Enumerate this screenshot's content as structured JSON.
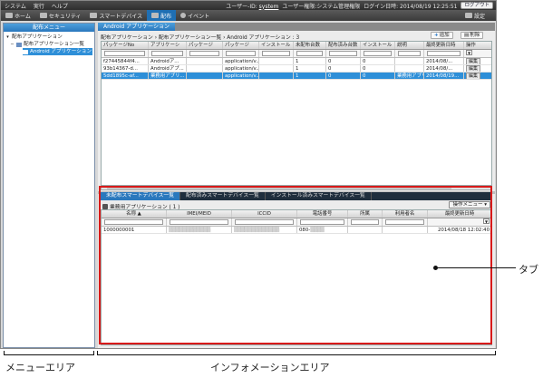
{
  "menubar": {
    "items": [
      "システム",
      "実行",
      "ヘルプ"
    ],
    "user_prefix": "ユーザー-ID:",
    "user_id": "system",
    "rights": "ユーザー権限:システム管理権限",
    "login": "ログイン日時: 2014/08/19 12:25:51",
    "logout": "ログアウト"
  },
  "tabbar": {
    "tabs": [
      "ホーム",
      "セキュリティ",
      "スマートデバイス",
      "配布",
      "イベント"
    ],
    "settings": "設定"
  },
  "sidemenu": {
    "title": "配布メニュー",
    "tree": [
      "配布アプリケーション",
      "配布アプリケーション一覧",
      "Android アプリケーション"
    ]
  },
  "info": {
    "tab": "Android アプリケーション",
    "breadcrumb": "配布アプリケーション › 配布アプリケーション一覧 › Android アプリケーション : 3",
    "add": "追加",
    "delete": "削除",
    "columns": [
      "パッケージNo",
      "アプリケーシ",
      "パッケージ",
      "パッケージ",
      "インストール",
      "未配布台数",
      "配布済み台数",
      "インストール",
      "説明",
      "最終更新日時",
      "操作"
    ],
    "rows": [
      [
        "f27445844f4...",
        "Androidア...",
        "",
        "application/v...",
        "",
        "1",
        "0",
        "0",
        "",
        "2014/08/...",
        "編集"
      ],
      [
        "93b14367-d...",
        "Androidアプ...",
        "",
        "application/v...",
        "",
        "1",
        "0",
        "0",
        "",
        "2014/08/...",
        "編集"
      ],
      [
        "5dd1895c-af...",
        "業務用アプリ...",
        "",
        "application/v...",
        "",
        "1",
        "0",
        "0",
        "業務用アプリ...",
        "2014/08/19...",
        "編集"
      ]
    ]
  },
  "lower": {
    "tabs": [
      "未配布スマートデバイス一覧",
      "配布済みスマートデバイス一覧",
      "インストール済みスマートデバイス一覧"
    ],
    "label": "業務用アプリケーション ( 1 )",
    "opmenu": "操作メニュー",
    "columns": [
      "名称",
      "IMEI/MEID",
      "ICCID",
      "電話番号",
      "所属",
      "利用者名",
      "最終更新日時"
    ],
    "row": [
      "1000000001",
      "",
      "",
      "080-",
      "",
      "",
      "2014/08/18 12:02:40"
    ]
  },
  "annotations": {
    "tab_label": "タブ",
    "menu_area": "メニューエリア",
    "info_area": "インフォメーションエリア"
  }
}
